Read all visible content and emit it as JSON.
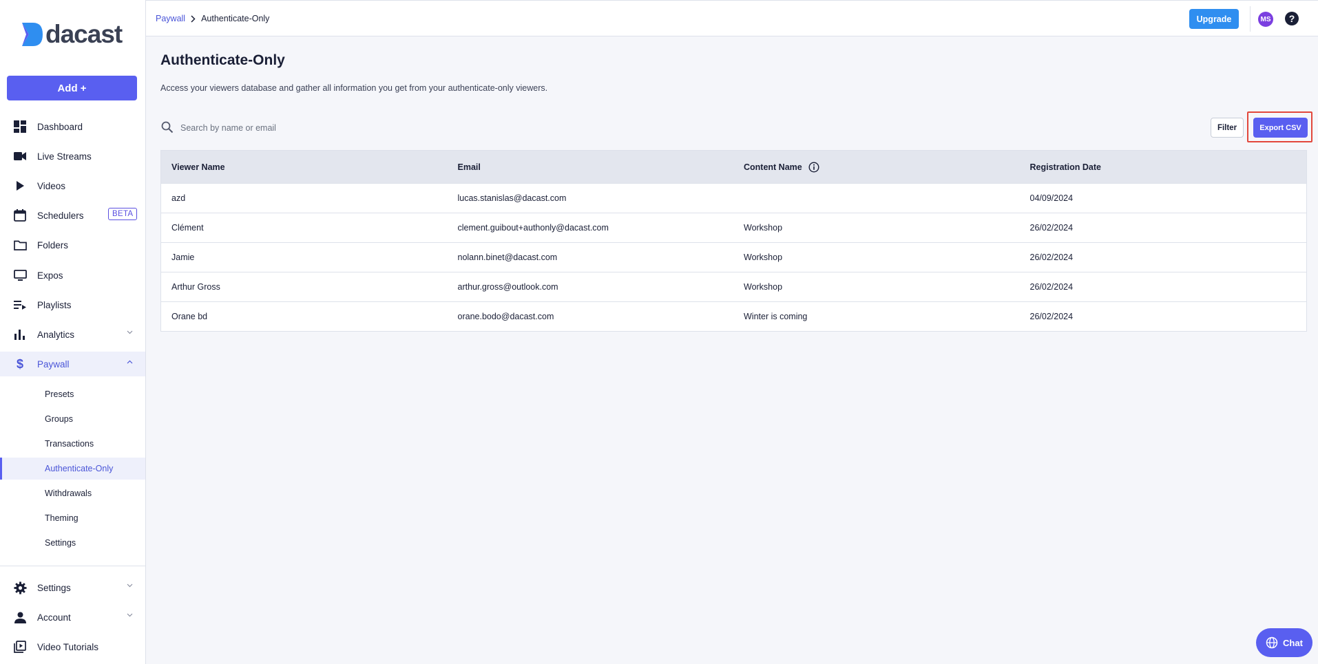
{
  "brand": {
    "name": "dacast",
    "accent": "#595ff0"
  },
  "sidebar": {
    "add_label": "Add +",
    "nav": [
      {
        "label": "Dashboard",
        "icon": "dashboard-icon"
      },
      {
        "label": "Live Streams",
        "icon": "video-camera-icon"
      },
      {
        "label": "Videos",
        "icon": "play-icon"
      },
      {
        "label": "Schedulers",
        "icon": "calendar-icon",
        "badge": "BETA"
      },
      {
        "label": "Folders",
        "icon": "folder-icon"
      },
      {
        "label": "Expos",
        "icon": "monitor-icon"
      },
      {
        "label": "Playlists",
        "icon": "playlist-icon"
      },
      {
        "label": "Analytics",
        "icon": "bar-chart-icon"
      },
      {
        "label": "Paywall",
        "icon": "dollar-icon"
      }
    ],
    "paywall_sub": [
      "Presets",
      "Groups",
      "Transactions",
      "Authenticate-Only",
      "Withdrawals",
      "Theming",
      "Settings"
    ],
    "bottom_nav": [
      {
        "label": "Settings",
        "icon": "gear-icon"
      },
      {
        "label": "Account",
        "icon": "person-icon"
      },
      {
        "label": "Video Tutorials",
        "icon": "video-library-icon"
      }
    ]
  },
  "topbar": {
    "breadcrumb": {
      "parent": "Paywall",
      "current": "Authenticate-Only"
    },
    "upgrade_label": "Upgrade",
    "avatar_initials": "MS"
  },
  "main": {
    "title": "Authenticate-Only",
    "description": "Access your viewers database and gather all information you get from your authenticate-only viewers.",
    "search_placeholder": "Search by name or email",
    "filter_label": "Filter",
    "export_label": "Export CSV",
    "table": {
      "headers": [
        "Viewer Name",
        "Email",
        "Content Name",
        "Registration Date"
      ],
      "rows": [
        [
          "azd",
          "lucas.stanislas@dacast.com",
          "",
          "04/09/2024"
        ],
        [
          "Clément",
          "clement.guibout+authonly@dacast.com",
          "Workshop",
          "26/02/2024"
        ],
        [
          "Jamie",
          "nolann.binet@dacast.com",
          "Workshop",
          "26/02/2024"
        ],
        [
          "Arthur Gross",
          "arthur.gross@outlook.com",
          "Workshop",
          "26/02/2024"
        ],
        [
          "Orane bd",
          "orane.bodo@dacast.com",
          "Winter is coming",
          "26/02/2024"
        ]
      ]
    }
  },
  "chat_label": "Chat"
}
